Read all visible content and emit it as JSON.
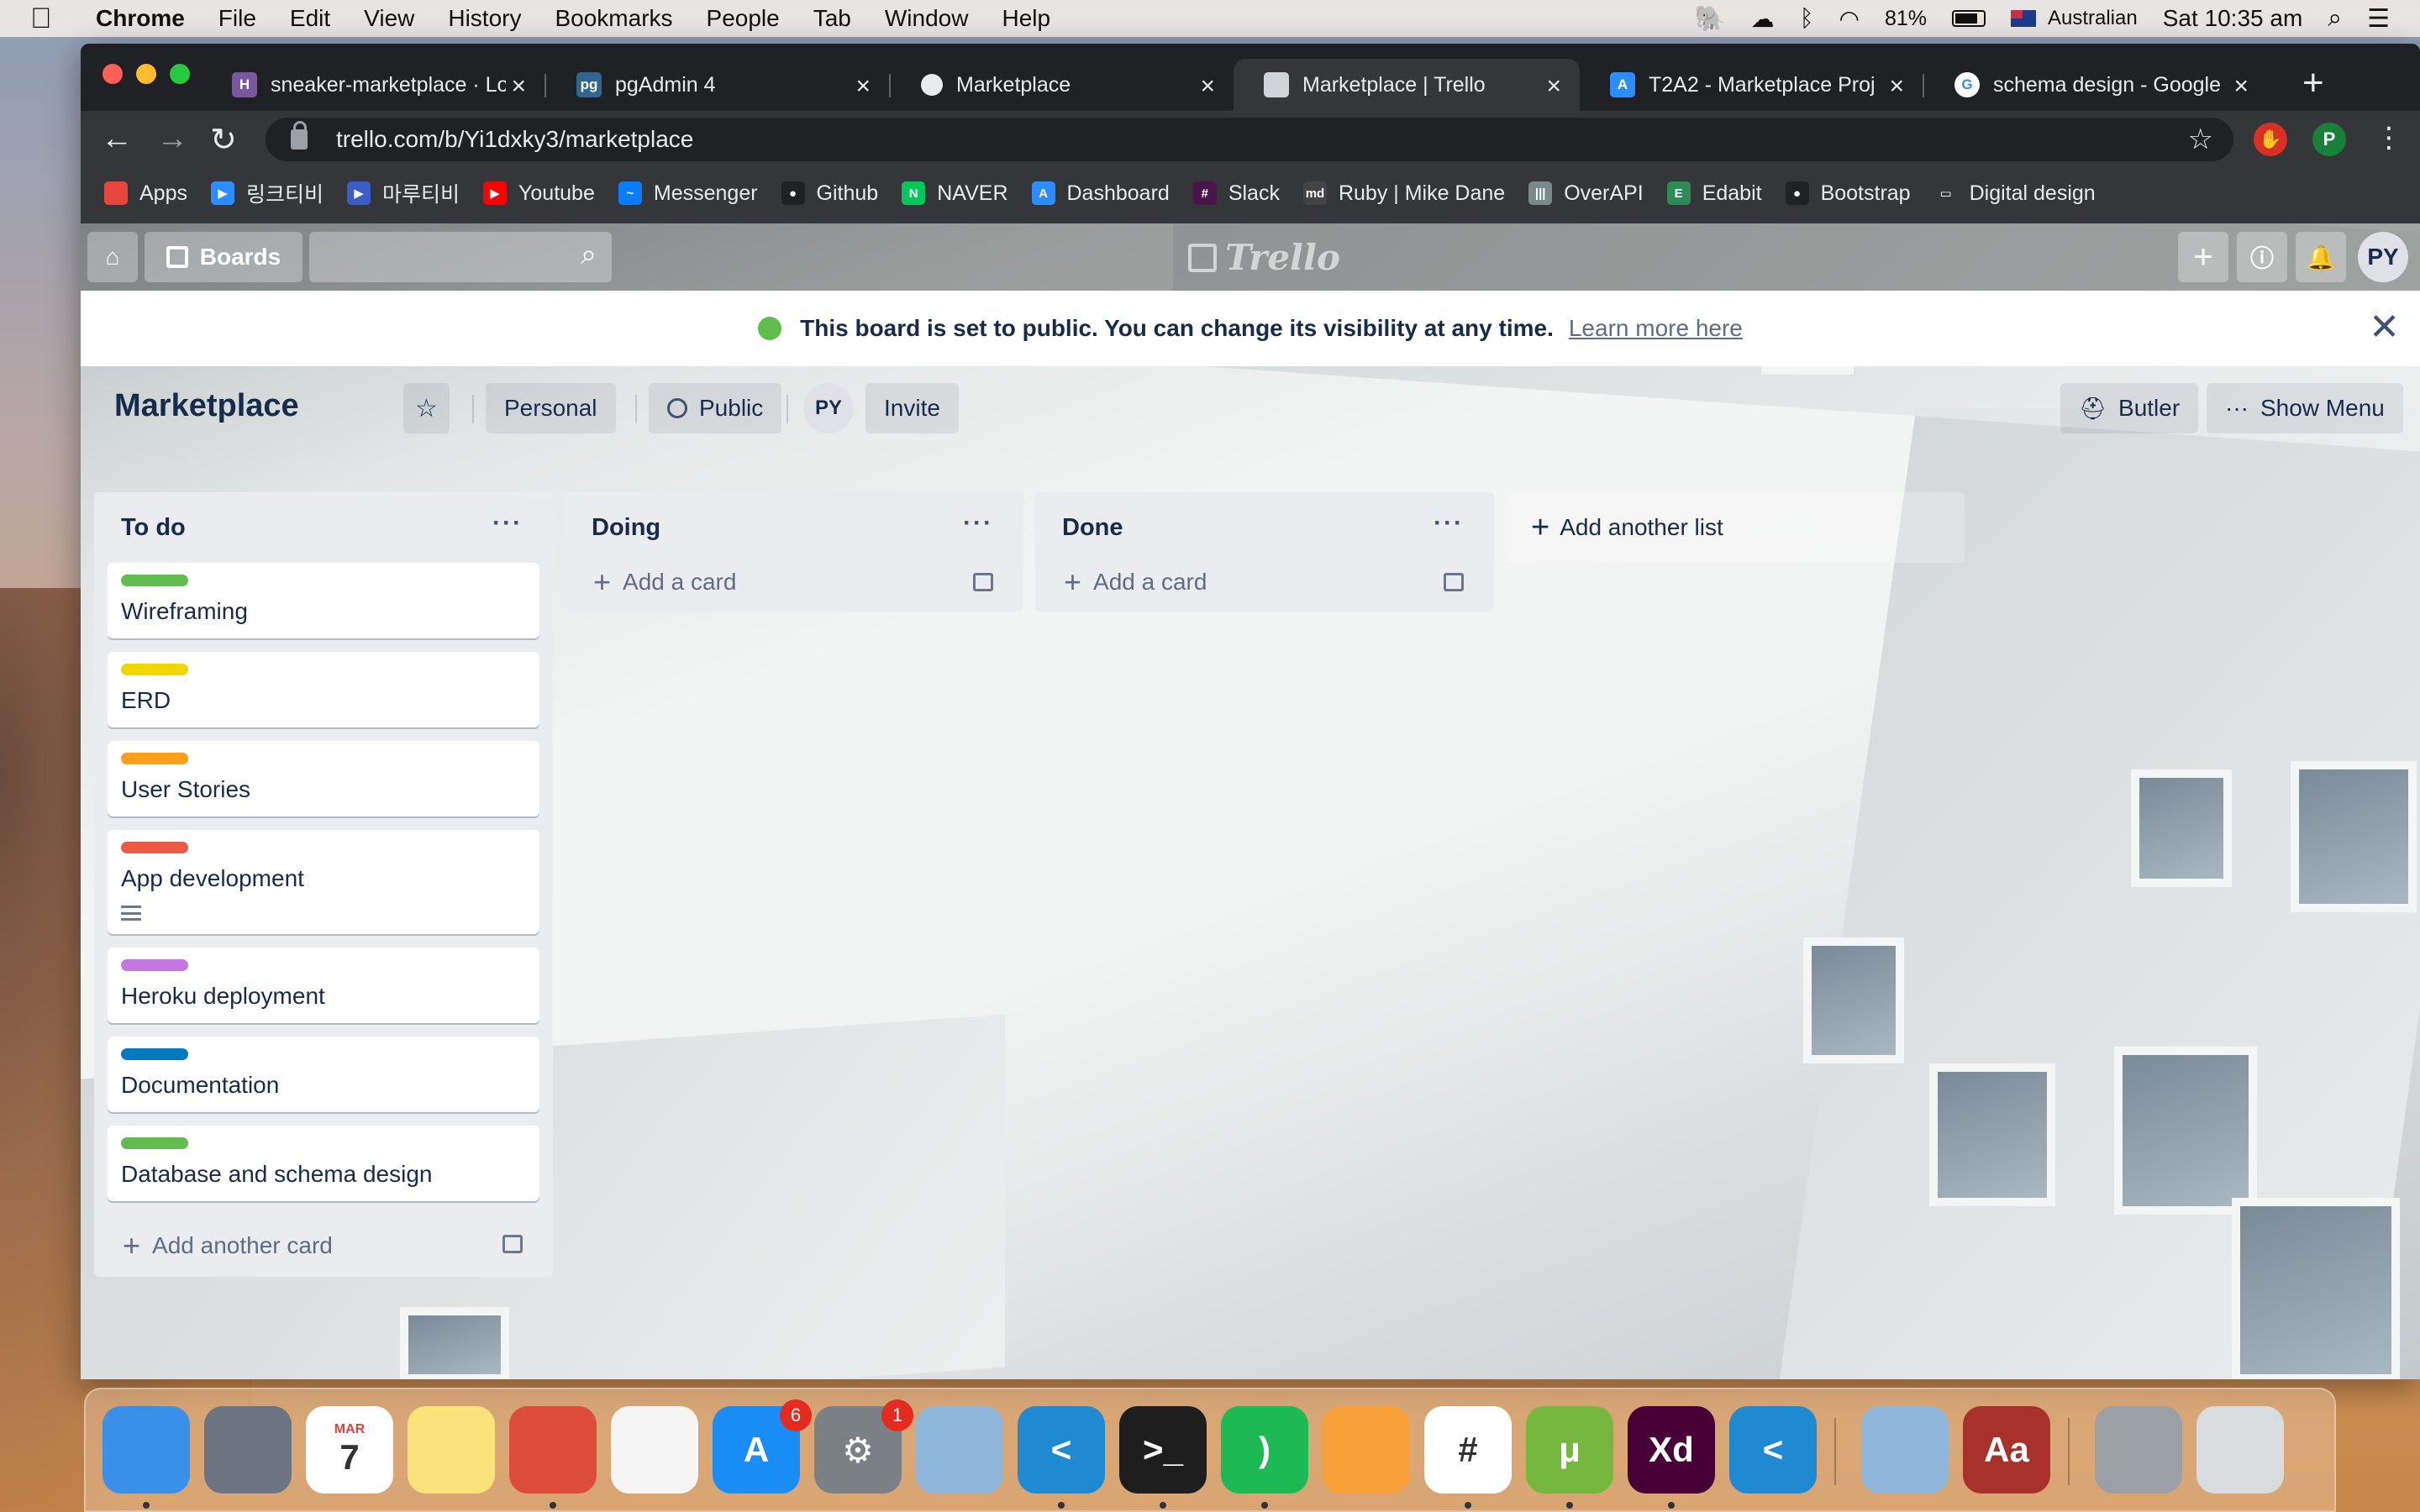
{
  "menubar": {
    "app": "Chrome",
    "items": [
      "File",
      "Edit",
      "View",
      "History",
      "Bookmarks",
      "People",
      "Tab",
      "Window",
      "Help"
    ],
    "battery": "81%",
    "input_source": "Australian",
    "clock": "Sat 10:35 am"
  },
  "tabs": [
    {
      "title": "sneaker-marketplace · Lo",
      "icon": "heroku-icon",
      "icon_text": "H",
      "color": "#79589f"
    },
    {
      "title": "pgAdmin 4",
      "icon": "pgadmin-icon",
      "icon_text": "pg",
      "color": "#326690"
    },
    {
      "title": "Marketplace",
      "icon": "globe-icon",
      "icon_text": "",
      "color": "#e8eaed"
    },
    {
      "title": "Marketplace | Trello",
      "icon": "trello-icon",
      "icon_text": "",
      "color": "#d0d4d8",
      "active": true
    },
    {
      "title": "T2A2 - Marketplace Proj",
      "icon": "canvas-icon",
      "icon_text": "A",
      "color": "#2d8cff"
    },
    {
      "title": "schema design - Google",
      "icon": "google-icon",
      "icon_text": "G",
      "color": "#ffffff"
    }
  ],
  "omnibox": {
    "url": "trello.com/b/Yi1dxky3/marketplace"
  },
  "profile_initial": "P",
  "bookmarks": [
    {
      "label": "Apps",
      "color": "#e8453c",
      "icon": "apps-grid-icon",
      "t": ""
    },
    {
      "label": "링크티비",
      "color": "#2d8cff",
      "icon": "link-tv-icon",
      "t": "▶"
    },
    {
      "label": "마루티비",
      "color": "#3c5cc7",
      "icon": "maru-tv-icon",
      "t": "▶"
    },
    {
      "label": "Youtube",
      "color": "#ff0000",
      "icon": "youtube-icon",
      "t": "▶"
    },
    {
      "label": "Messenger",
      "color": "#0a7cff",
      "icon": "messenger-icon",
      "t": "~"
    },
    {
      "label": "Github",
      "color": "#202124",
      "icon": "github-icon",
      "t": "●"
    },
    {
      "label": "NAVER",
      "color": "#03c75a",
      "icon": "naver-icon",
      "t": "N"
    },
    {
      "label": "Dashboard",
      "color": "#2d8cff",
      "icon": "canvas-icon",
      "t": "A"
    },
    {
      "label": "Slack",
      "color": "#4a154b",
      "icon": "slack-icon",
      "t": "#"
    },
    {
      "label": "Ruby | Mike Dane",
      "color": "#444444",
      "icon": "md-icon",
      "t": "md"
    },
    {
      "label": "OverAPI",
      "color": "#7a8a8a",
      "icon": "overapi-icon",
      "t": "|||"
    },
    {
      "label": "Edabit",
      "color": "#2e8b57",
      "icon": "edabit-icon",
      "t": "E"
    },
    {
      "label": "Bootstrap",
      "color": "#202124",
      "icon": "bootstrap-icon",
      "t": "●"
    },
    {
      "label": "Digital design",
      "color": "#35363a",
      "icon": "folder-icon",
      "t": "▭"
    }
  ],
  "trello_header": {
    "boards": "Boards",
    "logo": "Trello",
    "avatar": "PY"
  },
  "banner": {
    "message": "This board is set to public. You can change its visibility at any time.",
    "link": "Learn more here"
  },
  "board": {
    "title": "Marketplace",
    "team": "Personal",
    "visibility": "Public",
    "member": "PY",
    "invite": "Invite",
    "butler": "Butler",
    "show_menu": "Show Menu"
  },
  "lists": [
    {
      "name": "To do",
      "cards": [
        {
          "title": "Wireframing",
          "label": "#61bd4f"
        },
        {
          "title": "ERD",
          "label": "#f2d600"
        },
        {
          "title": "User Stories",
          "label": "#ff9f1a"
        },
        {
          "title": "App development",
          "label": "#eb5a46",
          "has_description": true
        },
        {
          "title": "Heroku deployment",
          "label": "#c377e0"
        },
        {
          "title": "Documentation",
          "label": "#0079bf"
        },
        {
          "title": "Database and schema design",
          "label": "#61bd4f"
        }
      ],
      "add": "Add another card"
    },
    {
      "name": "Doing",
      "cards": [],
      "add": "Add a card"
    },
    {
      "name": "Done",
      "cards": [],
      "add": "Add a card"
    }
  ],
  "add_list": "Add another list",
  "dock": [
    {
      "name": "finder-icon",
      "color": "#3a8fe8",
      "t": ""
    },
    {
      "name": "launchpad-icon",
      "color": "#6b7480",
      "t": ""
    },
    {
      "name": "calendar-icon",
      "color": "#ffffff",
      "t": "7",
      "sub": "MAR"
    },
    {
      "name": "notes-icon",
      "color": "#fbe27a",
      "t": ""
    },
    {
      "name": "chrome-icon",
      "color": "#dd4b39",
      "t": ""
    },
    {
      "name": "photos-icon",
      "color": "#f5f5f5",
      "t": ""
    },
    {
      "name": "app-store-icon",
      "color": "#1b8ef5",
      "t": "A",
      "badge": "6"
    },
    {
      "name": "system-preferences-icon",
      "color": "#7b7f86",
      "t": "⚙",
      "badge": "1"
    },
    {
      "name": "preview-icon",
      "color": "#8fb6d8",
      "t": ""
    },
    {
      "name": "vscode-icon",
      "color": "#1f8ad2",
      "t": "<"
    },
    {
      "name": "terminal-icon",
      "color": "#1e1e1e",
      "t": ">_"
    },
    {
      "name": "spotify-icon",
      "color": "#1db954",
      "t": ")"
    },
    {
      "name": "pages-icon",
      "color": "#f7a03a",
      "t": ""
    },
    {
      "name": "slack-icon",
      "color": "#ffffff",
      "t": "#"
    },
    {
      "name": "utorrent-icon",
      "color": "#76b83f",
      "t": "μ"
    },
    {
      "name": "adobe-xd-icon",
      "color": "#470137",
      "t": "Xd"
    },
    {
      "name": "vscode-insiders-icon",
      "color": "#1f8ad2",
      "t": "<"
    },
    {
      "name": "mail-icon",
      "color": "#8fb6d8",
      "t": ""
    },
    {
      "name": "dictionary-icon",
      "color": "#a8322b",
      "t": "Aa"
    },
    {
      "name": "downloads-stack-icon",
      "color": "#9aa0a6",
      "t": ""
    },
    {
      "name": "trash-icon",
      "color": "#d8dcdf",
      "t": ""
    }
  ]
}
